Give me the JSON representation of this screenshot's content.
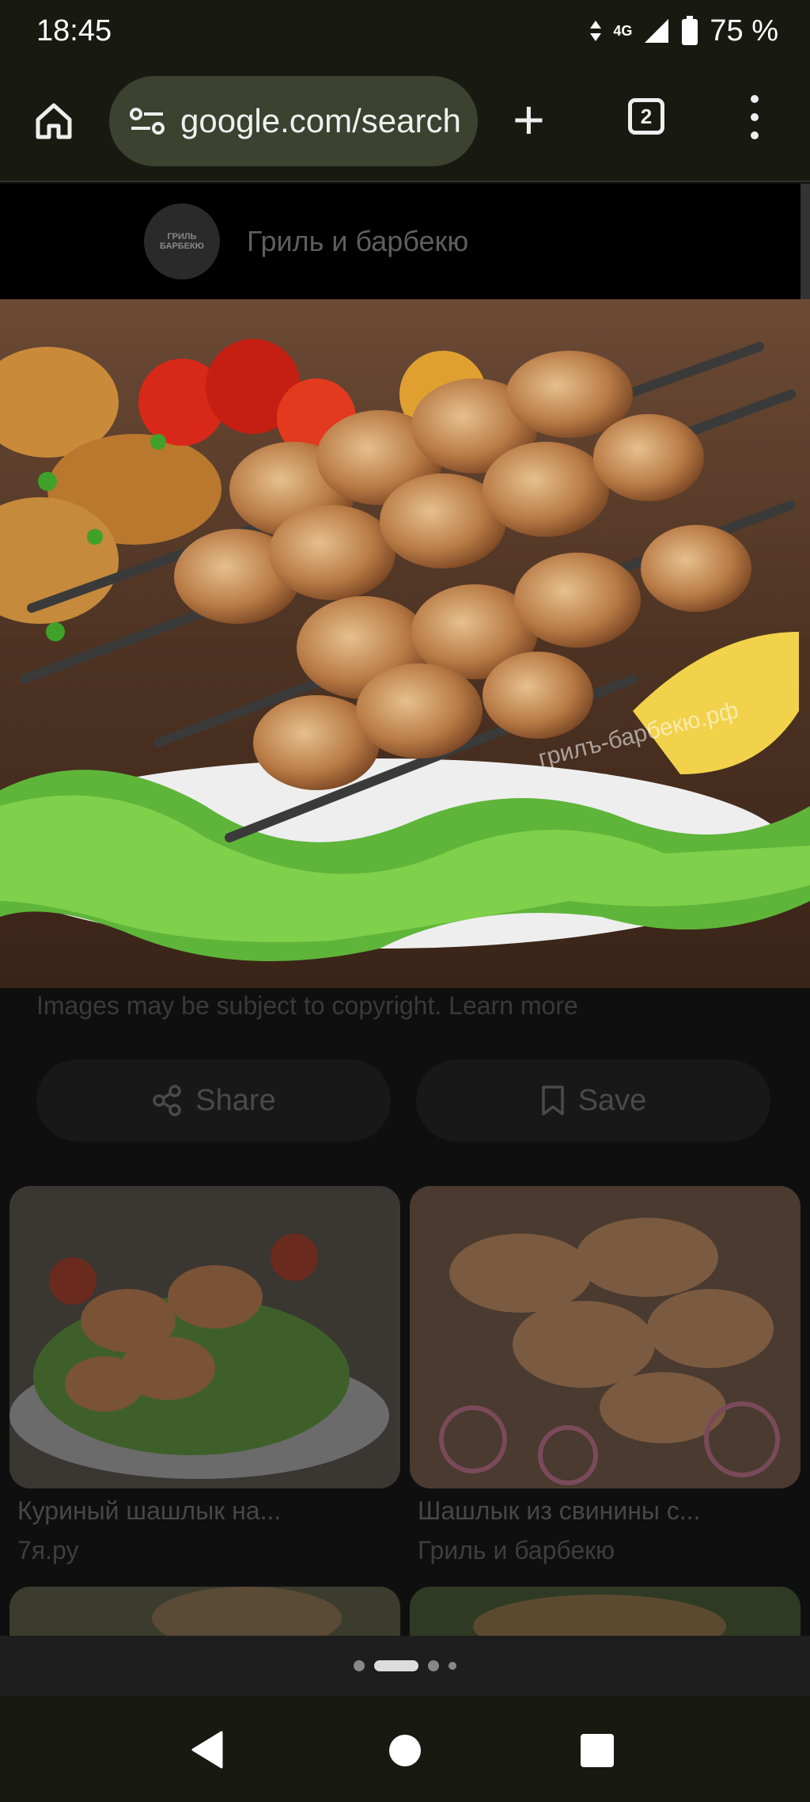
{
  "status": {
    "time": "18:45",
    "network": "4G",
    "battery": "75 %"
  },
  "browser": {
    "url": "google.com/search",
    "tab_count": "2"
  },
  "source": {
    "name": "Гриль и барбекю",
    "logo_text": "ГРИЛЬ БАРБЕКЮ"
  },
  "image": {
    "watermark": "грилъ-барбекю.рф"
  },
  "copyright": "Images may be subject to copyright. Learn more",
  "actions": {
    "share": "Share",
    "save": "Save"
  },
  "related": [
    {
      "title": "Куриный шашлык на...",
      "source": "7я.ру"
    },
    {
      "title": "Шашлык из свинины с...",
      "source": "Гриль и барбекю"
    }
  ],
  "pager": {
    "count": 4,
    "active": 1
  },
  "icons": {
    "home": "home-icon",
    "site_settings": "tune-icon",
    "new_tab": "plus-icon",
    "tabs": "tab-switcher-icon",
    "menu": "more-vert-icon",
    "share": "share-icon",
    "save": "bookmark-icon"
  }
}
